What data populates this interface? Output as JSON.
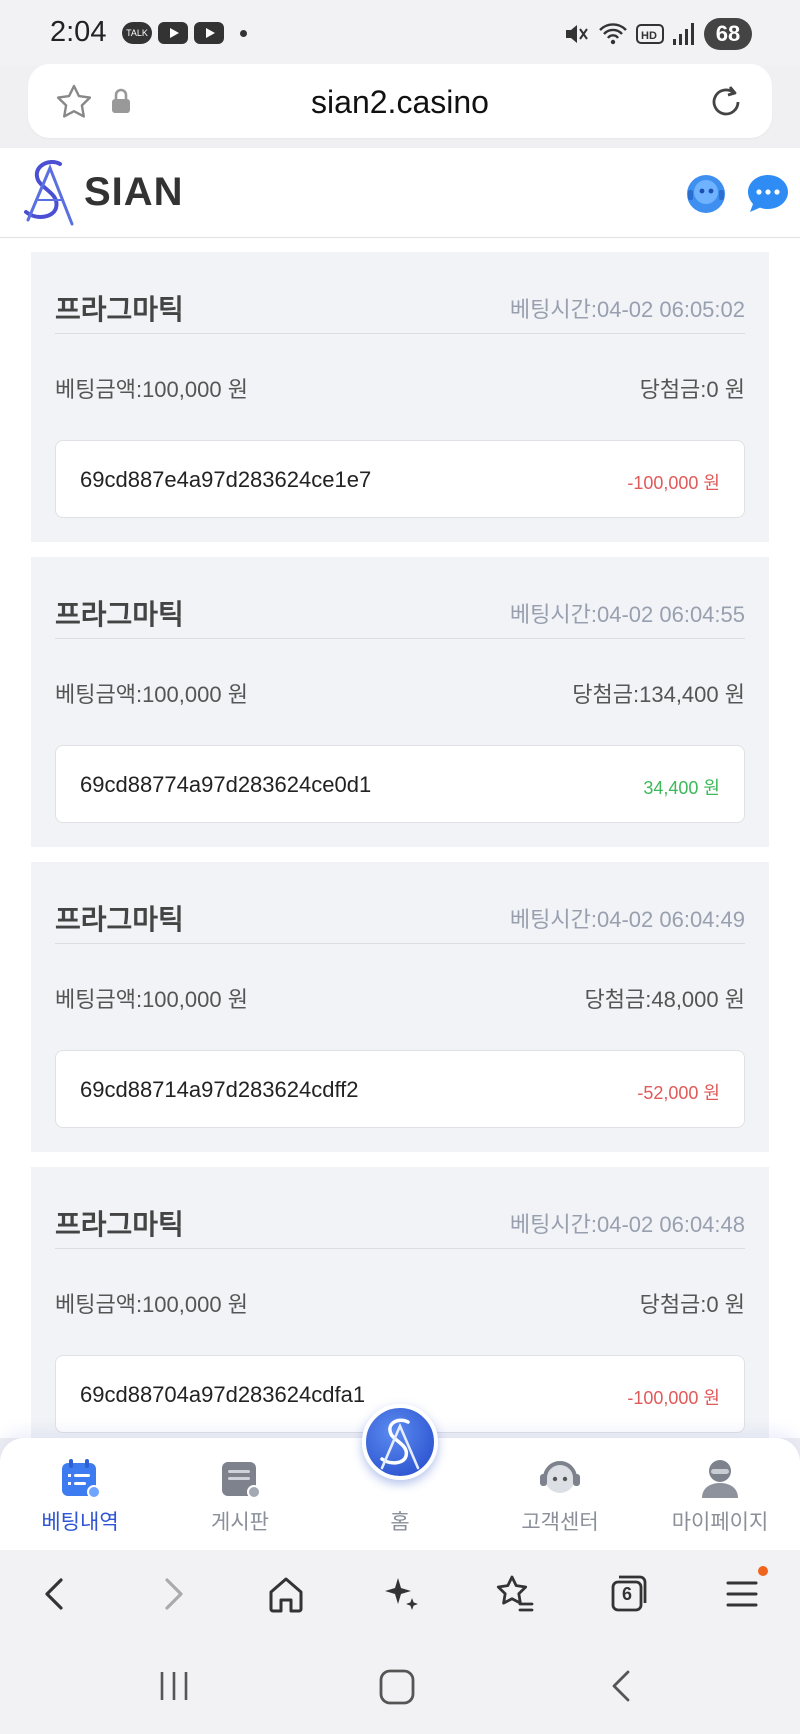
{
  "status_bar": {
    "time": "2:04",
    "talk_label": "TALK",
    "battery": "68"
  },
  "browser": {
    "url": "sian2.casino",
    "tabs_count": "6"
  },
  "app": {
    "brand": "SIAN"
  },
  "bets": [
    {
      "title": "프라그마틱",
      "time": "베팅시간:04-02 06:05:02",
      "bet_amount": "베팅금액:100,000 원",
      "win_amount": "당첨금:0 원",
      "id": "69cd887e4a97d283624ce1e7",
      "profit": "-100,000 원",
      "profit_color": "#e05a5a"
    },
    {
      "title": "프라그마틱",
      "time": "베팅시간:04-02 06:04:55",
      "bet_amount": "베팅금액:100,000 원",
      "win_amount": "당첨금:134,400 원",
      "id": "69cd88774a97d283624ce0d1",
      "profit": "34,400 원",
      "profit_color": "#3cb95a"
    },
    {
      "title": "프라그마틱",
      "time": "베팅시간:04-02 06:04:49",
      "bet_amount": "베팅금액:100,000 원",
      "win_amount": "당첨금:48,000 원",
      "id": "69cd88714a97d283624cdff2",
      "profit": "-52,000 원",
      "profit_color": "#e05a5a"
    },
    {
      "title": "프라그마틱",
      "time": "베팅시간:04-02 06:04:48",
      "bet_amount": "베팅금액:100,000 원",
      "win_amount": "당첨금:0 원",
      "id": "69cd88704a97d283624cdfa1",
      "profit": "-100,000 원",
      "profit_color": "#e05a5a"
    }
  ],
  "tabbar": {
    "betting_history": "베팅내역",
    "board": "게시판",
    "home": "홈",
    "support": "고객센터",
    "mypage": "마이페이지"
  },
  "colors": {
    "accent": "#2f55d4",
    "loss": "#e05a5a",
    "gain": "#3cb95a"
  }
}
